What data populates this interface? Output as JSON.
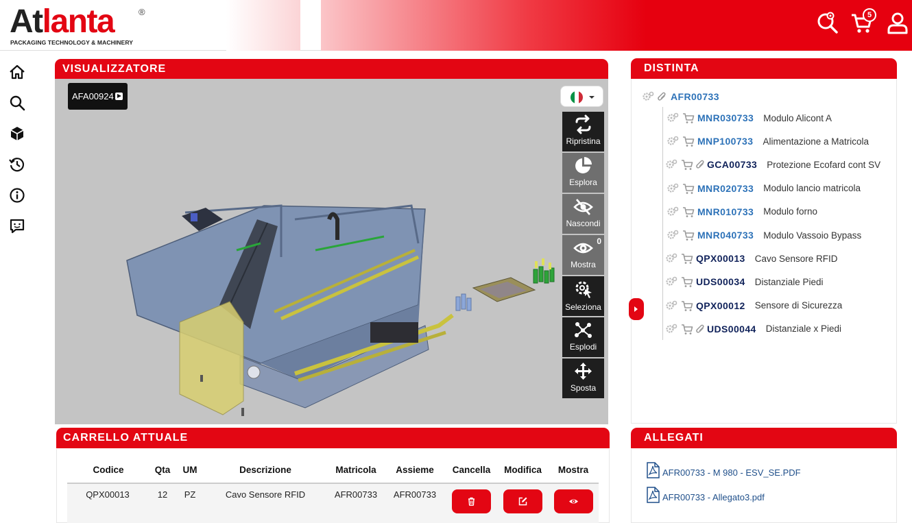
{
  "brand": {
    "name_dark": "At",
    "name_red": "lanta",
    "registered": "®",
    "tagline": "PACKAGING TECHNOLOGY & MACHINERY"
  },
  "header": {
    "cart_count": "5",
    "icons": [
      "search-settings-icon",
      "cart-icon",
      "user-icon"
    ]
  },
  "sidebar": {
    "items": [
      {
        "icon": "home-icon"
      },
      {
        "icon": "search-icon"
      },
      {
        "icon": "box-icon"
      },
      {
        "icon": "history-icon"
      },
      {
        "icon": "info-icon"
      },
      {
        "icon": "feedback-icon"
      }
    ]
  },
  "viewer": {
    "title": "VISUALIZZATORE",
    "model_code": "AFA00924",
    "language_flag": "italy-flag",
    "tools": [
      {
        "label": "Ripristina",
        "icon": "reset-icon"
      },
      {
        "label": "Esplora",
        "icon": "pie-icon"
      },
      {
        "label": "Nascondi",
        "icon": "eye-off-icon"
      },
      {
        "label": "Mostra",
        "icon": "eye-icon",
        "count": "0"
      },
      {
        "label": "Seleziona",
        "icon": "select-gear-icon"
      },
      {
        "label": "Esplodi",
        "icon": "explode-icon"
      },
      {
        "label": "Sposta",
        "icon": "move-icon"
      }
    ]
  },
  "distinta": {
    "title": "DISTINTA",
    "root": {
      "code": "AFR00733"
    },
    "items": [
      {
        "code": "MNR030733",
        "desc": "Modulo Alicont A",
        "color": "blue",
        "clip": false
      },
      {
        "code": "MNP100733",
        "desc": "Alimentazione a Matricola",
        "color": "blue",
        "clip": false
      },
      {
        "code": "GCA00733",
        "desc": "Protezione Ecofard cont SV",
        "color": "dark",
        "clip": true
      },
      {
        "code": "MNR020733",
        "desc": "Modulo lancio matricola",
        "color": "blue",
        "clip": false
      },
      {
        "code": "MNR010733",
        "desc": "Modulo forno",
        "color": "blue",
        "clip": false
      },
      {
        "code": "MNR040733",
        "desc": "Modulo Vassoio Bypass",
        "color": "blue",
        "clip": false
      },
      {
        "code": "QPX00013",
        "desc": "Cavo Sensore RFID",
        "color": "dark",
        "clip": false
      },
      {
        "code": "UDS00034",
        "desc": "Distanziale Piedi",
        "color": "dark",
        "clip": false
      },
      {
        "code": "QPX00012",
        "desc": "Sensore di Sicurezza",
        "color": "dark",
        "clip": false
      },
      {
        "code": "UDS00044",
        "desc": "Distanziale x Piedi",
        "color": "dark",
        "clip": true
      }
    ]
  },
  "cart": {
    "title": "CARRELLO ATTUALE",
    "columns": [
      "Codice",
      "Qta",
      "UM",
      "Descrizione",
      "Matricola",
      "Assieme",
      "Cancella",
      "Modifica",
      "Mostra"
    ],
    "rows": [
      {
        "codice": "QPX00013",
        "qta": "12",
        "um": "PZ",
        "descrizione": "Cavo Sensore RFID",
        "matricola": "AFR00733",
        "assieme": "AFR00733"
      }
    ]
  },
  "allegati": {
    "title": "ALLEGATI",
    "files": [
      "AFR00733 - M 980 - ESV_SE.PDF",
      "AFR00733 - Allegato3.pdf"
    ]
  },
  "colors": {
    "accent": "#e30613",
    "link": "#2d72b8",
    "dark_code": "#10225a"
  }
}
